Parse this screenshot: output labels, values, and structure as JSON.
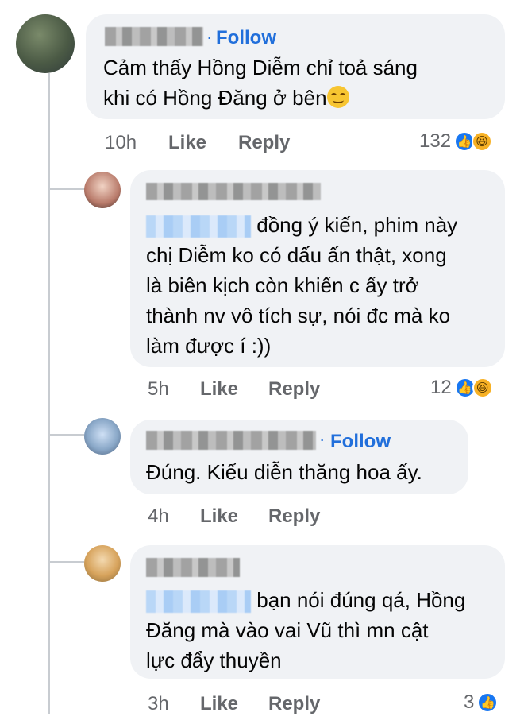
{
  "comments": [
    {
      "follow": "Follow",
      "text_lines": [
        "Cảm thấy Hồng Diễm chỉ toả sáng",
        "khi có Hồng Đăng ở bên"
      ],
      "time": "10h",
      "like": "Like",
      "reply": "Reply",
      "reaction_count": "132"
    },
    {
      "text_lines": [
        "đồng ý kiến, phim này",
        "chị Diễm ko có dấu ấn thật, xong",
        "là biên kịch còn khiến c ấy trở",
        "thành nv vô tích sự, nói đc mà ko",
        "làm được í :))"
      ],
      "time": "5h",
      "like": "Like",
      "reply": "Reply",
      "reaction_count": "12"
    },
    {
      "follow": "Follow",
      "text_lines": [
        "Đúng. Kiểu diễn thăng hoa ấy."
      ],
      "time": "4h",
      "like": "Like",
      "reply": "Reply"
    },
    {
      "text_lines": [
        "bạn nói đúng qá, Hồng",
        "Đăng mà vào vai Vũ thì mn cật",
        "lực đẩy thuyền"
      ],
      "time": "3h",
      "like": "Like",
      "reply": "Reply",
      "reaction_count": "3"
    }
  ],
  "colors": {
    "bubble": "#f0f2f5",
    "follow": "#216fdb",
    "meta": "#65676b",
    "like_icon": "#1877f2",
    "haha_icon": "#f7b125"
  },
  "icons": [
    "like-reaction-icon",
    "haha-reaction-icon",
    "smiling-emoji-icon"
  ]
}
